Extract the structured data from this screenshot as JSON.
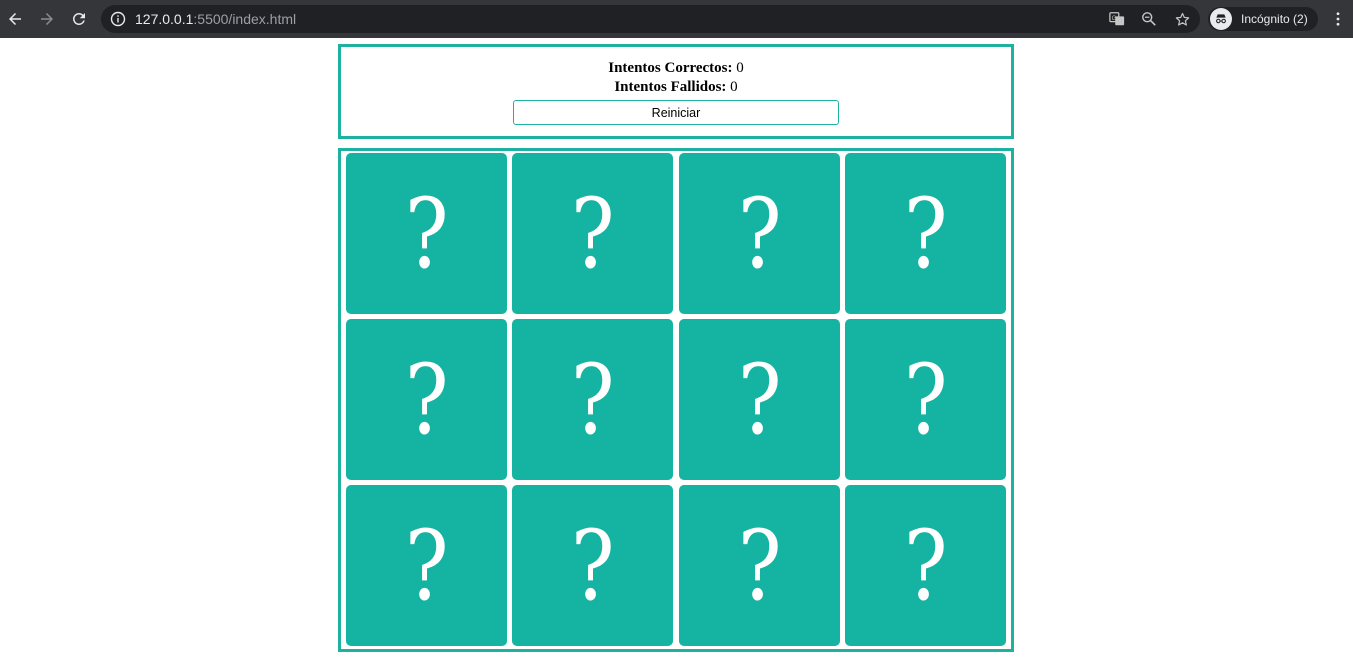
{
  "browser": {
    "url_host": "127.0.0.1",
    "url_rest": ":5500/index.html",
    "profile_label": "Incógnito (2)"
  },
  "score": {
    "correct_label": "Intentos Correctos:",
    "correct_value": "0",
    "failed_label": "Intentos Fallidos:",
    "failed_value": "0",
    "restart_label": "Reiniciar"
  },
  "board": {
    "cards": [
      "?",
      "?",
      "?",
      "?",
      "?",
      "?",
      "?",
      "?",
      "?",
      "?",
      "?",
      "?"
    ]
  },
  "colors": {
    "accent": "#1fb1a0",
    "card": "#15b3a1"
  }
}
